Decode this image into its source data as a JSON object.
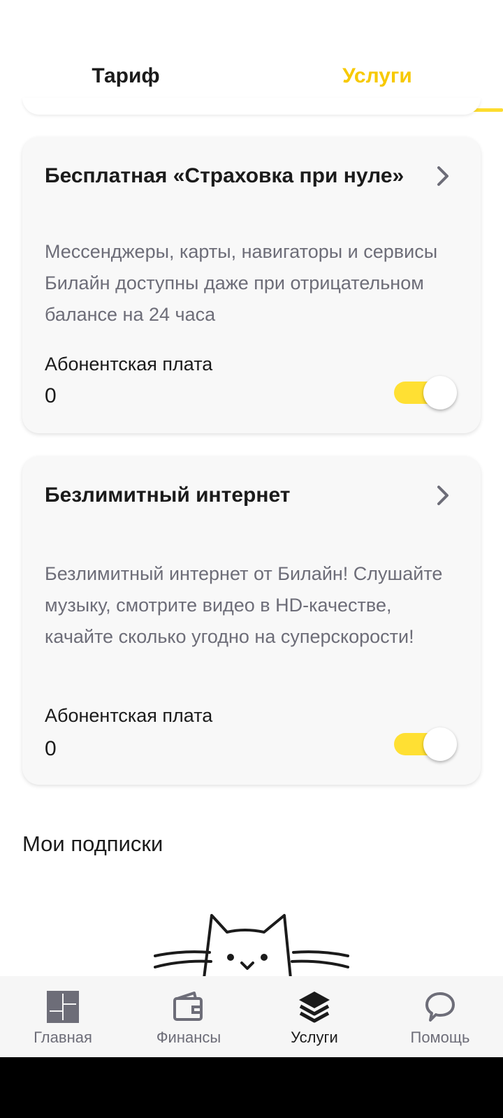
{
  "tabs": {
    "tariff": "Тариф",
    "services": "Услуги",
    "active": "services",
    "accent_color": "#FDDC2E"
  },
  "services": [
    {
      "title": "Бесплатная «Страховка при нуле»",
      "description": "Мессенджеры, карты, навигаторы и сервисы Билайн доступны даже при отрицательном балансе на 24 часа",
      "fee_label": "Абонентская плата",
      "fee_value": "0",
      "enabled": true
    },
    {
      "title": "Безлимитный интернет",
      "description": "Безлимитный интернет от Билайн! Слушайте музыку, смотрите видео в HD-качестве, качайте сколько угодно на суперскорости!",
      "fee_label": "Абонентская плата",
      "fee_value": "0",
      "enabled": true
    }
  ],
  "subscriptions": {
    "title": "Мои подписки",
    "illustration": "cat-icon"
  },
  "bottom_nav": {
    "items": [
      {
        "label": "Главная",
        "icon": "dashboard-icon"
      },
      {
        "label": "Финансы",
        "icon": "wallet-icon"
      },
      {
        "label": "Услуги",
        "icon": "layers-icon",
        "active": true
      },
      {
        "label": "Помощь",
        "icon": "chat-bubble-icon"
      }
    ]
  }
}
